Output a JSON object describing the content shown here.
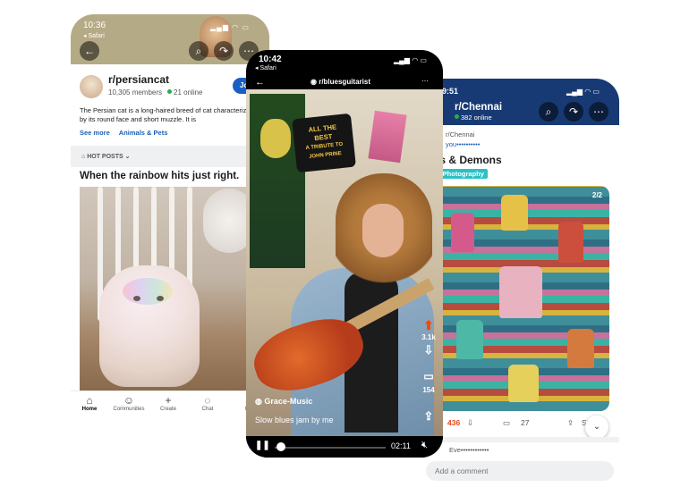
{
  "left": {
    "time": "10:36",
    "back_app": "◂ Safari",
    "subreddit": "r/persiancat",
    "members": "10,305 members",
    "online": "21 online",
    "join_label": "Jo",
    "description": "The Persian cat is a long-haired breed of cat characterized by its round face and short muzzle. It is",
    "see_more": "See more",
    "tag": "Animals & Pets",
    "sort_label": "HOT POSTS",
    "post_title": "When the rainbow hits just right.",
    "tabs": [
      "Home",
      "Communities",
      "Create",
      "Chat",
      "In"
    ]
  },
  "center": {
    "time": "10:42",
    "back_app": "◂ Safari",
    "subreddit": "r/bluesguitarist",
    "sign_lines": [
      "ALL THE",
      "BEST",
      "A TRIBUTE TO",
      "JOHN PRINE"
    ],
    "upvotes": "3.1k",
    "comments": "154",
    "user": "Grace-Music",
    "caption": "Slow blues jam by me",
    "duration": "02:11",
    "progress": 0.03
  },
  "right": {
    "time": "9:51",
    "subreddit": "r/Chennai",
    "online": "382 online",
    "post_sub": "r/Chennai",
    "post_user": "you••••••••••",
    "post_title": "ds & Demons",
    "flair": "g/Photography",
    "counter": "2/2",
    "votes": "436",
    "comments": "27",
    "share": "Sh",
    "comment_user": "Eve••••••••••••",
    "comment_placeholder": "Add a comment"
  }
}
